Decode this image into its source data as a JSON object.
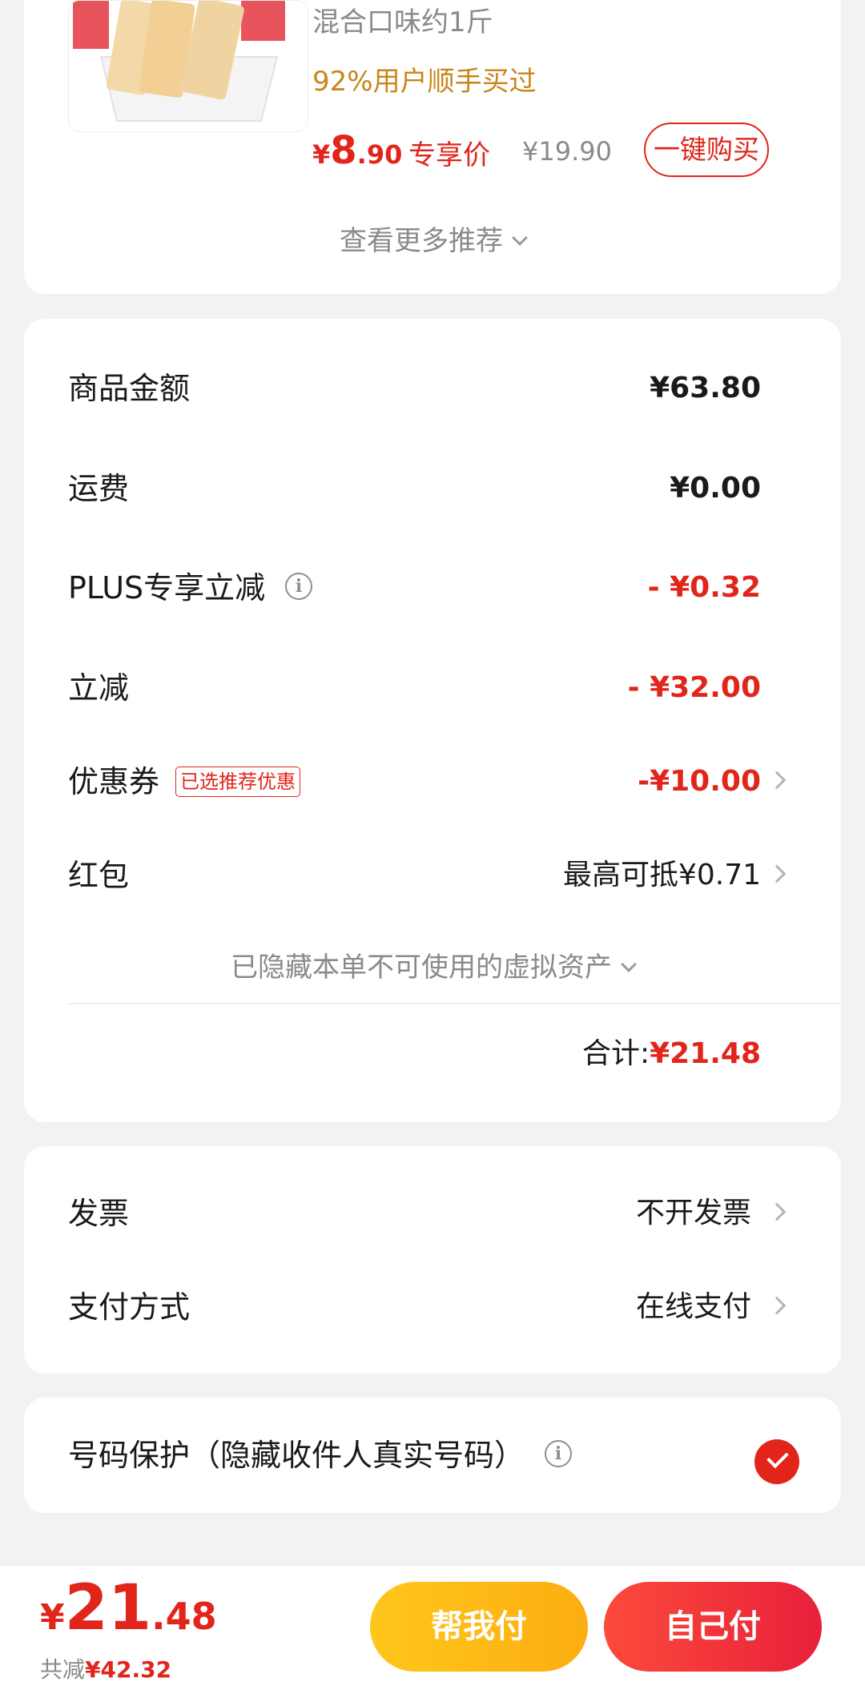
{
  "recommendation": {
    "product_name": "混合口味约1斤",
    "bought_text": "92%用户顺手买过",
    "price": {
      "symbol": "¥",
      "integer": "8",
      "decimal": ".90"
    },
    "price_tag": "专享价",
    "original_price": "¥19.90",
    "buy_button": "一键购买",
    "see_more": "查看更多推荐"
  },
  "summary": {
    "rows": [
      {
        "label": "商品金额",
        "value": "¥63.80"
      },
      {
        "label": "运费",
        "value": "¥0.00"
      },
      {
        "label": "PLUS专享立减",
        "value": "- ¥0.32"
      },
      {
        "label": "立减",
        "value": "- ¥32.00"
      },
      {
        "label": "优惠券",
        "tag": "已选推荐优惠",
        "value": "-¥10.00"
      },
      {
        "label": "红包",
        "value": "最高可抵¥0.71"
      }
    ],
    "hidden_note": "已隐藏本单不可使用的虚拟资产",
    "total_label": "合计:",
    "total_value": "¥21.48"
  },
  "invoice": {
    "rows": [
      {
        "label": "发票",
        "value": "不开发票"
      },
      {
        "label": "支付方式",
        "value": "在线支付"
      }
    ]
  },
  "privacy": {
    "label": "号码保护（隐藏收件人真实号码）",
    "checked": true
  },
  "bottom_bar": {
    "total": {
      "symbol": "¥",
      "integer": "21",
      "decimal": ".48"
    },
    "saved_label": "共减",
    "saved_value": "¥42.32",
    "help_pay_button": "帮我付",
    "self_pay_button": "自己付"
  },
  "colors": {
    "accent_red": "#e1251b",
    "gold": "#c8861b",
    "help_button": "#fcb415"
  },
  "icons": [
    "product-thumbnail",
    "chevron-down-icon",
    "info-icon",
    "chevron-right-icon",
    "checkmark-icon"
  ]
}
